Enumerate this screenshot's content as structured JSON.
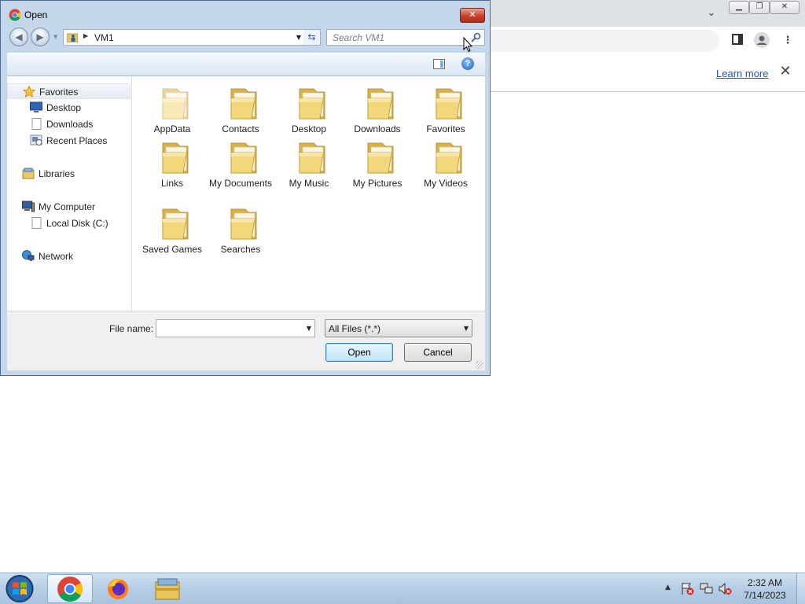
{
  "browser": {
    "learn_more_label": "Learn more",
    "tab_search_icon": "chevron-down-icon",
    "window_controls": [
      "minimize-icon",
      "restore-icon",
      "close-icon"
    ]
  },
  "dialog": {
    "title": "Open",
    "address": {
      "path": "VM1"
    },
    "search": {
      "placeholder": "Search VM1"
    },
    "navigation": [
      {
        "label": "Favorites",
        "icon": "star-icon"
      },
      {
        "label": "Desktop",
        "icon": "desktop-icon"
      },
      {
        "label": "Downloads",
        "icon": "downloads-icon"
      },
      {
        "label": "Recent Places",
        "icon": "recent-places-icon"
      },
      {
        "label": "Libraries",
        "icon": "libraries-icon"
      },
      {
        "label": "My Computer",
        "icon": "computer-icon"
      },
      {
        "label": "Local Disk (C:)",
        "icon": "disk-icon"
      },
      {
        "label": "Network",
        "icon": "network-icon"
      }
    ],
    "folders": [
      {
        "label": "AppData"
      },
      {
        "label": "Contacts"
      },
      {
        "label": "Desktop"
      },
      {
        "label": "Downloads"
      },
      {
        "label": "Favorites"
      },
      {
        "label": "Links"
      },
      {
        "label": "My Documents"
      },
      {
        "label": "My Music"
      },
      {
        "label": "My Pictures"
      },
      {
        "label": "My Videos"
      },
      {
        "label": "Saved Games"
      },
      {
        "label": "Searches"
      }
    ],
    "file_name_label": "File name:",
    "file_name_value": "",
    "file_type": "All Files (*.*)",
    "open_label": "Open",
    "cancel_label": "Cancel"
  },
  "taskbar": {
    "apps": [
      "chrome-icon",
      "firefox-icon",
      "file-explorer-icon"
    ],
    "clock": {
      "time": "2:32 AM",
      "date": "7/14/2023"
    }
  },
  "colors": {
    "dialog_frame": "#c5d7ea",
    "link": "#1a56c8",
    "taskbar": "#b7cfe6"
  }
}
